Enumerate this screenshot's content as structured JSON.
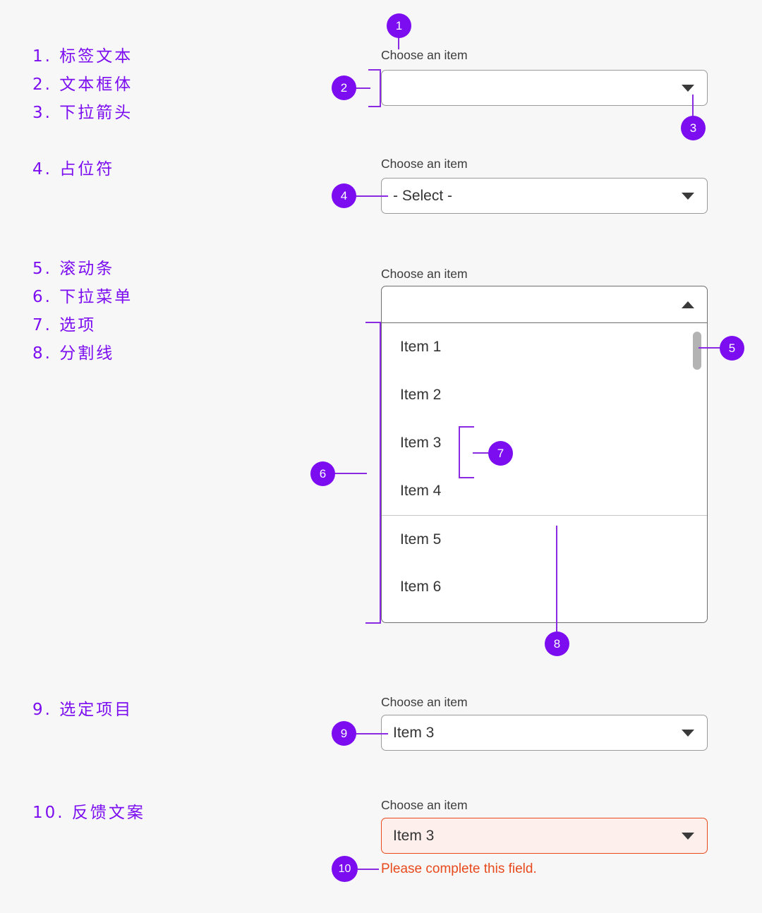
{
  "page": {
    "background": "#f7f7f7",
    "accent": "#7B0DF0",
    "error_color": "#e8491d"
  },
  "legend": {
    "items": [
      {
        "num": "1",
        "text": "1. 标签文本"
      },
      {
        "num": "2",
        "text": "2. 文本框体"
      },
      {
        "num": "3",
        "text": "3. 下拉箭头"
      },
      {
        "num": "4",
        "text": "4. 占位符"
      },
      {
        "num": "5",
        "text": "5. 滚动条"
      },
      {
        "num": "6",
        "text": "6. 下拉菜单"
      },
      {
        "num": "7",
        "text": "7. 选项"
      },
      {
        "num": "8",
        "text": "8. 分割线"
      },
      {
        "num": "9",
        "text": "9. 选定项目"
      },
      {
        "num": "10",
        "text": "10. 反馈文案"
      }
    ]
  },
  "fields": {
    "empty": {
      "label": "Choose an item",
      "value": "",
      "arrow": "chevron-down-icon"
    },
    "placeholder": {
      "label": "Choose an item",
      "value": "- Select -",
      "arrow": "chevron-down-icon"
    },
    "expanded": {
      "label": "Choose an item",
      "value": "",
      "arrow": "chevron-up-icon",
      "options": [
        {
          "label": "Item 1",
          "divider_above": false
        },
        {
          "label": "Item 2",
          "divider_above": false
        },
        {
          "label": "Item 3",
          "divider_above": false
        },
        {
          "label": "Item 4",
          "divider_above": false
        },
        {
          "label": "Item 5",
          "divider_above": true
        },
        {
          "label": "Item 6",
          "divider_above": false
        }
      ]
    },
    "selected": {
      "label": "Choose an item",
      "value": "Item 3",
      "arrow": "chevron-down-icon"
    },
    "error": {
      "label": "Choose an item",
      "value": "Item 3",
      "arrow": "chevron-down-icon",
      "message": "Please complete this field."
    }
  },
  "badges": {
    "b1": "1",
    "b2": "2",
    "b3": "3",
    "b4": "4",
    "b5": "5",
    "b6": "6",
    "b7": "7",
    "b8": "8",
    "b9": "9",
    "b10": "10"
  }
}
